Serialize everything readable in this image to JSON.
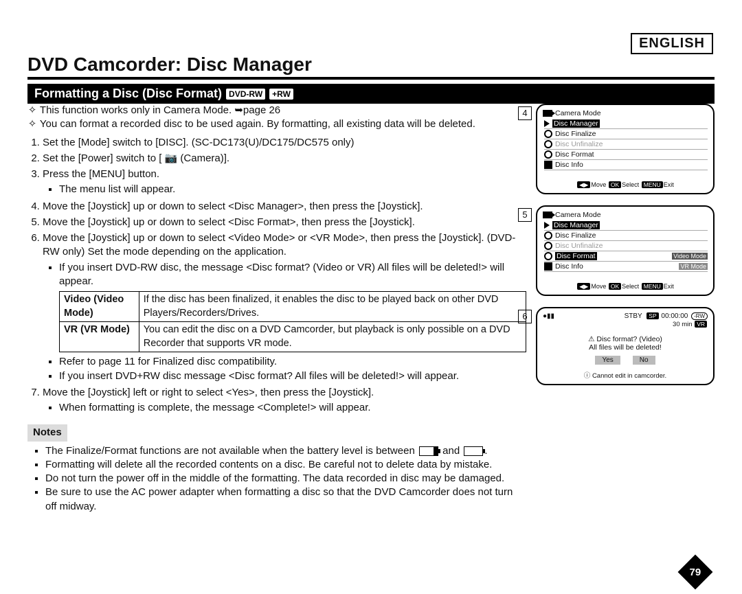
{
  "language": "ENGLISH",
  "title": "DVD Camcorder: Disc Manager",
  "section_header": "Formatting a Disc (Disc Format)",
  "section_tags": [
    "DVD-RW",
    "+RW"
  ],
  "intro": [
    "This function works only in Camera Mode. ➥page 26",
    "You can format a recorded disc to be used again. By formatting, all existing data will be deleted."
  ],
  "steps": {
    "s1": "Set the [Mode] switch to [DISC]. (SC-DC173(U)/DC175/DC575 only)",
    "s2": "Set the [Power] switch to [ 📷 (Camera)].",
    "s3": "Press the [MENU] button.",
    "s3_sub": "The menu list will appear.",
    "s4": "Move the [Joystick] up or down to select <Disc Manager>, then press the [Joystick].",
    "s5": "Move the [Joystick] up or down to select <Disc Format>, then press the [Joystick].",
    "s6": "Move the [Joystick] up or down to select <Video Mode> or <VR Mode>, then press the [Joystick]. (DVD-RW only) Set the mode depending on the application.",
    "s6_sub": "If you insert DVD-RW disc, the message <Disc format? (Video or VR) All files will be deleted!> will appear.",
    "s6_after1": "Refer to page 11 for Finalized disc compatibility.",
    "s6_after2": "If you insert DVD+RW disc message <Disc format? All files will be deleted!> will appear.",
    "s7": "Move the [Joystick] left or right to select <Yes>, then press the [Joystick].",
    "s7_sub": "When formatting is complete, the message <Complete!> will appear."
  },
  "mode_table": {
    "r1_label": "Video (Video Mode)",
    "r1_desc": "If the disc has been finalized, it enables the disc to be played back on other DVD Players/Recorders/Drives.",
    "r2_label": "VR (VR Mode)",
    "r2_desc": "You can edit the disc on a DVD Camcorder, but playback is only possible on a DVD Recorder that supports VR mode."
  },
  "notes_label": "Notes",
  "notes": [
    "The Finalize/Format functions are not available when the battery level is between [low] and [empty].",
    "Formatting will delete all the recorded contents on a disc. Be careful not to delete data by mistake.",
    "Do not turn the power off in the middle of the formatting. The data recorded in disc may be damaged.",
    "Be sure to use the AC power adapter when formatting a disc so that the DVD Camcorder does not turn off midway."
  ],
  "page_number": "79",
  "fig4": {
    "num": "4",
    "header": "Camera Mode",
    "rows": [
      "Disc Manager",
      "Disc Finalize",
      "Disc Unfinalize",
      "Disc Format",
      "Disc Info"
    ],
    "selected_index": 0,
    "footer_move": "Move",
    "footer_select": "Select",
    "footer_exit": "Exit"
  },
  "fig5": {
    "num": "5",
    "header": "Camera Mode",
    "rows": [
      "Disc Manager",
      "Disc Finalize",
      "Disc Unfinalize",
      "Disc Format",
      "Disc Info"
    ],
    "selected_index": 3,
    "sub_options": [
      "Video Mode",
      "VR Mode"
    ],
    "footer_move": "Move",
    "footer_select": "Select",
    "footer_exit": "Exit"
  },
  "fig6": {
    "num": "6",
    "stby": "STBY",
    "sp": "SP",
    "time": "00:00:00",
    "rw": "-RW",
    "remain": "30 min",
    "vr": "VR",
    "msg1": "Disc format? (Video)",
    "msg2": "All files will be deleted!",
    "yes": "Yes",
    "no": "No",
    "foot": "Cannot edit in camcorder."
  }
}
